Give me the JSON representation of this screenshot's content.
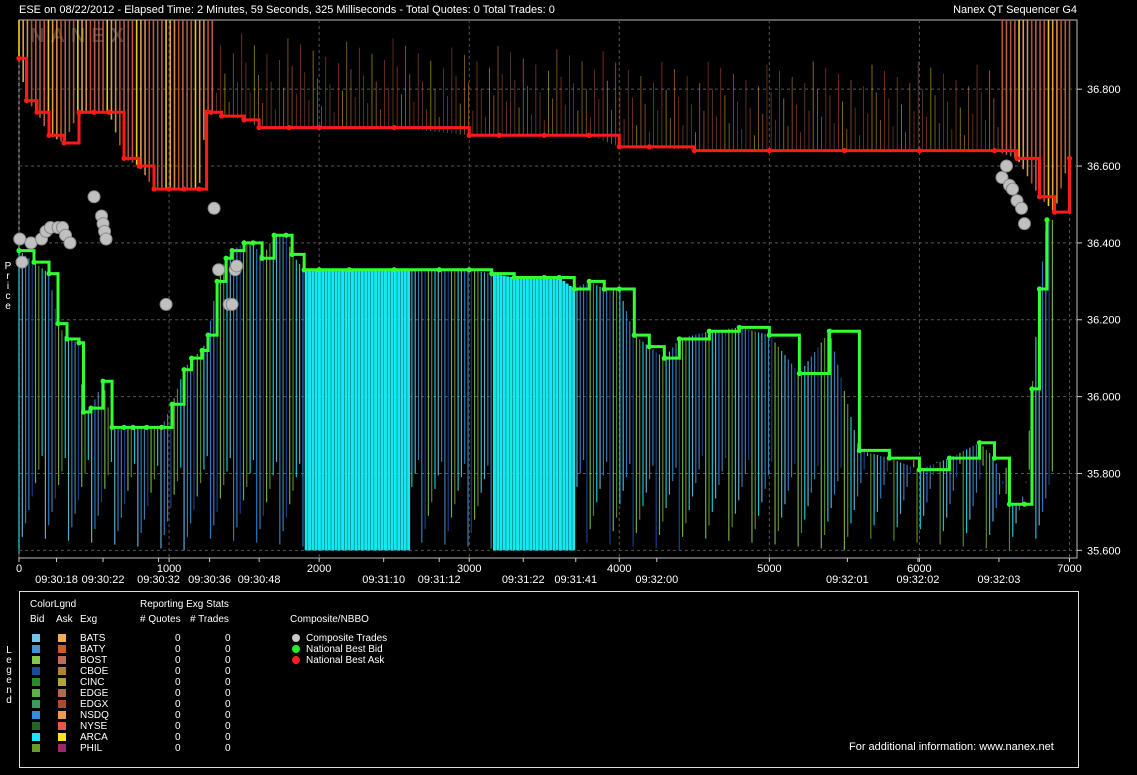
{
  "window": {
    "title_left": "ESE on 08/22/2012  -  Elapsed Time: 2 Minutes, 59 Seconds, 325 Milliseconds  -  Total Quotes: 0  Total Trades: 0",
    "title_right": "Nanex QT Sequencer G4",
    "watermark": "NANEX"
  },
  "axis_labels": {
    "y": "Price",
    "legend_side": "Legend"
  },
  "chart_data": {
    "type": "line",
    "y_ticks": [
      "36.800",
      "36.600",
      "36.400",
      "36.200",
      "36.000",
      "35.800",
      "35.600"
    ],
    "y_tick_values": [
      36.8,
      36.6,
      36.4,
      36.2,
      36.0,
      35.8,
      35.6
    ],
    "ylim": [
      35.58,
      36.98
    ],
    "xlim": [
      0,
      7050
    ],
    "x_ticks": [
      "0",
      "1000",
      "2000",
      "3000",
      "4000",
      "5000",
      "6000",
      "7000"
    ],
    "x_tick_values": [
      0,
      1000,
      2000,
      3000,
      4000,
      5000,
      6000,
      7000
    ],
    "time_ticks": [
      "09:30:18",
      "09:30:22",
      "09:30:32",
      "09:30:36",
      "09:30:48",
      "09:31:10",
      "09:31:12",
      "09:31:22",
      "09:31:41",
      "09:32:00",
      "09:32:01",
      "09:32:02",
      "09:32:03"
    ],
    "time_tick_positions": [
      250,
      560,
      930,
      1270,
      1600,
      2430,
      2800,
      3360,
      3710,
      4250,
      5520,
      5990,
      6530
    ],
    "grid": true,
    "series": [
      {
        "name": "National Best Bid",
        "color": "#33ff33",
        "x": [
          0,
          100,
          200,
          260,
          320,
          400,
          430,
          480,
          560,
          620,
          700,
          760,
          850,
          950,
          1020,
          1100,
          1150,
          1220,
          1260,
          1320,
          1380,
          1420,
          1500,
          1560,
          1620,
          1700,
          1780,
          1820,
          1900,
          2000,
          2200,
          2500,
          2800,
          3000,
          3150,
          3300,
          3500,
          3600,
          3700,
          3800,
          3900,
          4000,
          4100,
          4200,
          4300,
          4400,
          4600,
          4800,
          5000,
          5200,
          5400,
          5600,
          5800,
          6000,
          6200,
          6400,
          6500,
          6600,
          6700,
          6750,
          6800,
          6850
        ],
        "y": [
          36.38,
          36.35,
          36.32,
          36.19,
          36.15,
          36.14,
          35.96,
          35.97,
          36.04,
          35.92,
          35.92,
          35.92,
          35.92,
          35.92,
          35.98,
          36.07,
          36.1,
          36.12,
          36.16,
          36.3,
          36.36,
          36.38,
          36.4,
          36.4,
          36.36,
          36.42,
          36.42,
          36.37,
          36.33,
          36.33,
          36.33,
          36.33,
          36.33,
          36.33,
          36.32,
          36.31,
          36.31,
          36.31,
          36.28,
          36.3,
          36.28,
          36.28,
          36.16,
          36.13,
          36.1,
          36.15,
          36.17,
          36.18,
          36.16,
          36.06,
          36.17,
          35.86,
          35.84,
          35.81,
          35.84,
          35.88,
          35.84,
          35.72,
          35.72,
          36.02,
          36.28,
          36.46
        ]
      },
      {
        "name": "National Best Ask",
        "color": "#ff1a1a",
        "x": [
          0,
          50,
          120,
          200,
          300,
          400,
          500,
          600,
          700,
          800,
          900,
          1000,
          1100,
          1200,
          1250,
          1280,
          1350,
          1500,
          1600,
          1800,
          2000,
          2500,
          3000,
          3200,
          3500,
          3800,
          4000,
          4200,
          4500,
          5000,
          5500,
          6000,
          6500,
          6650,
          6800,
          6900,
          7000
        ],
        "y": [
          36.88,
          36.77,
          36.74,
          36.68,
          36.66,
          36.74,
          36.74,
          36.74,
          36.62,
          36.6,
          36.54,
          36.54,
          36.54,
          36.54,
          36.74,
          36.74,
          36.73,
          36.72,
          36.7,
          36.7,
          36.7,
          36.7,
          36.68,
          36.68,
          36.68,
          36.68,
          36.65,
          36.65,
          36.64,
          36.64,
          36.64,
          36.64,
          36.64,
          36.62,
          36.52,
          36.48,
          36.62
        ]
      },
      {
        "name": "Composite Trades",
        "color": "#c0c0c0",
        "x": [
          5,
          20,
          80,
          150,
          180,
          210,
          260,
          290,
          310,
          340,
          500,
          550,
          560,
          570,
          580,
          980,
          1300,
          1330,
          1400,
          1420,
          1440,
          1450,
          6550,
          6580,
          6600,
          6620,
          6650,
          6680,
          6700
        ],
        "y": [
          36.41,
          36.35,
          36.4,
          36.41,
          36.43,
          36.44,
          36.44,
          36.44,
          36.42,
          36.4,
          36.52,
          36.47,
          36.45,
          36.43,
          36.41,
          36.24,
          36.49,
          36.33,
          36.24,
          36.24,
          36.33,
          36.34,
          36.57,
          36.6,
          36.55,
          36.54,
          36.51,
          36.49,
          36.45
        ]
      }
    ]
  },
  "legend": {
    "color_legend_title": "ColorLgnd",
    "reporting_title": "Reporting Exg Stats",
    "composite_title": "Composite/NBBO",
    "col_bid": "Bid",
    "col_ask": "Ask",
    "col_exg": "Exg",
    "col_quotes": "# Quotes",
    "col_trades": "# Trades",
    "exchanges": [
      {
        "exg": "BATS",
        "bid_color": "#6ec6f0",
        "ask_color": "#f6b04a",
        "quotes": "0",
        "trades": "0"
      },
      {
        "exg": "BATY",
        "bid_color": "#4d8fc7",
        "ask_color": "#d05a24",
        "quotes": "0",
        "trades": "0"
      },
      {
        "exg": "BOST",
        "bid_color": "#86c64a",
        "ask_color": "#c46a5a",
        "quotes": "0",
        "trades": "0"
      },
      {
        "exg": "CBOE",
        "bid_color": "#1b4a9a",
        "ask_color": "#b08428",
        "quotes": "0",
        "trades": "0"
      },
      {
        "exg": "CINC",
        "bid_color": "#2c8a2c",
        "ask_color": "#b0a43a",
        "quotes": "0",
        "trades": "0"
      },
      {
        "exg": "EDGE",
        "bid_color": "#5bb04a",
        "ask_color": "#b06a4a",
        "quotes": "0",
        "trades": "0"
      },
      {
        "exg": "EDGX",
        "bid_color": "#3e9a5a",
        "ask_color": "#b04a2a",
        "quotes": "0",
        "trades": "0"
      },
      {
        "exg": "NSDQ",
        "bid_color": "#2f8fe0",
        "ask_color": "#ee9a4a",
        "quotes": "0",
        "trades": "0"
      },
      {
        "exg": "NYSE",
        "bid_color": "#226622",
        "ask_color": "#e05a4a",
        "quotes": "0",
        "trades": "0"
      },
      {
        "exg": "ARCA",
        "bid_color": "#15e8f0",
        "ask_color": "#ffe31a",
        "quotes": "0",
        "trades": "0"
      },
      {
        "exg": "PHIL",
        "bid_color": "#6a9a2a",
        "ask_color": "#9a2a6a",
        "quotes": "0",
        "trades": "0"
      }
    ],
    "composite_items": [
      {
        "label": "Composite Trades",
        "color": "#c8c8c8"
      },
      {
        "label": "National Best Bid",
        "color": "#22ee22"
      },
      {
        "label": "National Best Ask",
        "color": "#ff2020"
      }
    ],
    "footer": "For additional information: www.nanex.net"
  }
}
